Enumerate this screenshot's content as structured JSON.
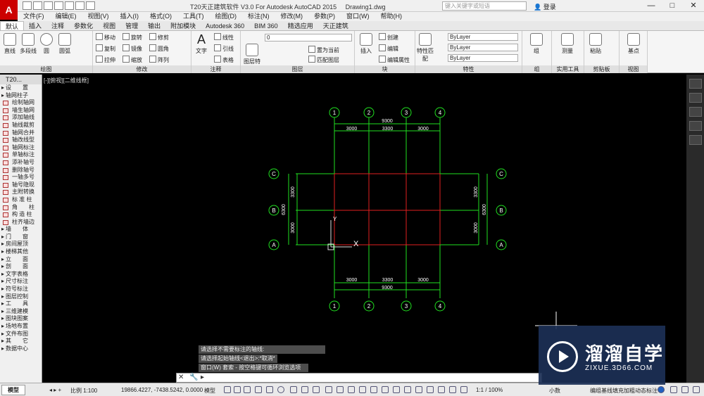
{
  "window": {
    "title": "T20天正建筑软件 V3.0 For Autodesk AutoCAD 2015",
    "filename": "Drawing1.dwg",
    "app_icon": "A",
    "search_placeholder": "键入关键字或短语",
    "login": "登录",
    "controls": [
      "—",
      "□",
      "✕"
    ]
  },
  "menubar": [
    "文件(F)",
    "编辑(E)",
    "视图(V)",
    "插入(I)",
    "格式(O)",
    "工具(T)",
    "绘图(D)",
    "标注(N)",
    "修改(M)",
    "参数(P)",
    "窗口(W)",
    "帮助(H)"
  ],
  "ribbon_tabs": [
    "默认",
    "插入",
    "注释",
    "参数化",
    "视图",
    "管理",
    "输出",
    "附加模块",
    "Autodesk 360",
    "BIM 360",
    "精选应用",
    "天正建筑"
  ],
  "ribbon": {
    "draw": {
      "title": "绘图",
      "big": [
        "直线",
        "多段线",
        "圆",
        "圆弧"
      ]
    },
    "modify": {
      "title": "修改",
      "items": [
        "移动",
        "旋转",
        "修剪",
        "复制",
        "镜像",
        "圆角",
        "拉伸",
        "缩放",
        "阵列"
      ]
    },
    "annotation": {
      "title": "注释",
      "big": "文字",
      "items": [
        "线性",
        "引线",
        "表格"
      ]
    },
    "layers": {
      "title": "图层",
      "big": "图层特性",
      "combo": "0",
      "items": [
        "置为当前",
        "匹配图层"
      ]
    },
    "block": {
      "title": "块",
      "big": "插入",
      "items": [
        "创建",
        "编辑",
        "编辑属性"
      ]
    },
    "properties": {
      "title": "特性",
      "big": "特性匹配",
      "color": "ByLayer",
      "linetype": "ByLayer",
      "lineweight": "ByLayer"
    },
    "groups": {
      "title": "组",
      "big": "组"
    },
    "utilities": {
      "title": "实用工具",
      "big": "测量"
    },
    "clipboard": {
      "title": "剪贴板",
      "big": "粘贴"
    },
    "view": {
      "title": "视图",
      "big": "基点"
    }
  },
  "viewport_label": "[-][俯视][二维线框]",
  "tool_panel": {
    "title": "T20...",
    "items": [
      {
        "label": "设　　置",
        "section": true
      },
      {
        "label": "轴网柱子",
        "section": true
      },
      {
        "label": "绘制轴网"
      },
      {
        "label": "墙生轴网"
      },
      {
        "label": "添加轴线"
      },
      {
        "label": "轴线裁剪"
      },
      {
        "label": "轴网合并"
      },
      {
        "label": "轴改线型"
      },
      {
        "label": "轴网标注"
      },
      {
        "label": "单轴标注"
      },
      {
        "label": "添补轴号"
      },
      {
        "label": "删除轴号"
      },
      {
        "label": "一轴多号"
      },
      {
        "label": "轴号隐现"
      },
      {
        "label": "主附转换"
      },
      {
        "label": "标 准 柱"
      },
      {
        "label": "角　　柱"
      },
      {
        "label": "构 造 柱"
      },
      {
        "label": "柱齐墙边"
      },
      {
        "label": "墙　　体",
        "section": true
      },
      {
        "label": "门　　窗",
        "section": true
      },
      {
        "label": "房间屋顶",
        "section": true
      },
      {
        "label": "楼梯其他",
        "section": true
      },
      {
        "label": "立　　面",
        "section": true
      },
      {
        "label": "剖　　面",
        "section": true
      },
      {
        "label": "文字表格",
        "section": true
      },
      {
        "label": "尺寸标注",
        "section": true
      },
      {
        "label": "符号标注",
        "section": true
      },
      {
        "label": "图层控制",
        "section": true
      },
      {
        "label": "工　　具",
        "section": true
      },
      {
        "label": "三维建模",
        "section": true
      },
      {
        "label": "图块图案",
        "section": true
      },
      {
        "label": "场地布置",
        "section": true
      },
      {
        "label": "文件布图",
        "section": true
      },
      {
        "label": "其　　它",
        "section": true
      },
      {
        "label": "数据中心",
        "section": true
      }
    ]
  },
  "drawing": {
    "axis_numbers": [
      "1",
      "2",
      "3",
      "4"
    ],
    "axis_letters": [
      "C",
      "B",
      "A"
    ],
    "top_total": "9300",
    "top_dims": [
      "3000",
      "3300",
      "3000"
    ],
    "bottom_total": "9300",
    "bottom_dims": [
      "3000",
      "3300",
      "3000"
    ],
    "left_dims": [
      "3300",
      "3000"
    ],
    "left_total": "6300",
    "right_dims": [
      "3300",
      "3000"
    ],
    "right_total": "6300",
    "ucs_y": "Y",
    "ucs_x": "X",
    "colors": {
      "axis_line": "#e02020",
      "dimension": "#20e020",
      "bubble": "#20e020",
      "text": "#ffffff"
    }
  },
  "command_history": [
    "请选择不需要标注的轴线:",
    "请选择起始轴线<退出>:*取消*",
    "窗口(W) 套索 - 按空格键可循环浏览选项"
  ],
  "command_input": "",
  "statusbar": {
    "model_tab": "模型",
    "scale": "比例 1:100",
    "coords": "19866.4227, -7438.5242, 0.0000",
    "mode": "模型",
    "annotation_scale": "1:1 / 100%",
    "units": "小数",
    "tip": "编组基线填充加粗动态标注"
  },
  "watermark": {
    "title": "溜溜自学",
    "subtitle": "ZIXUE.3D66.COM"
  }
}
